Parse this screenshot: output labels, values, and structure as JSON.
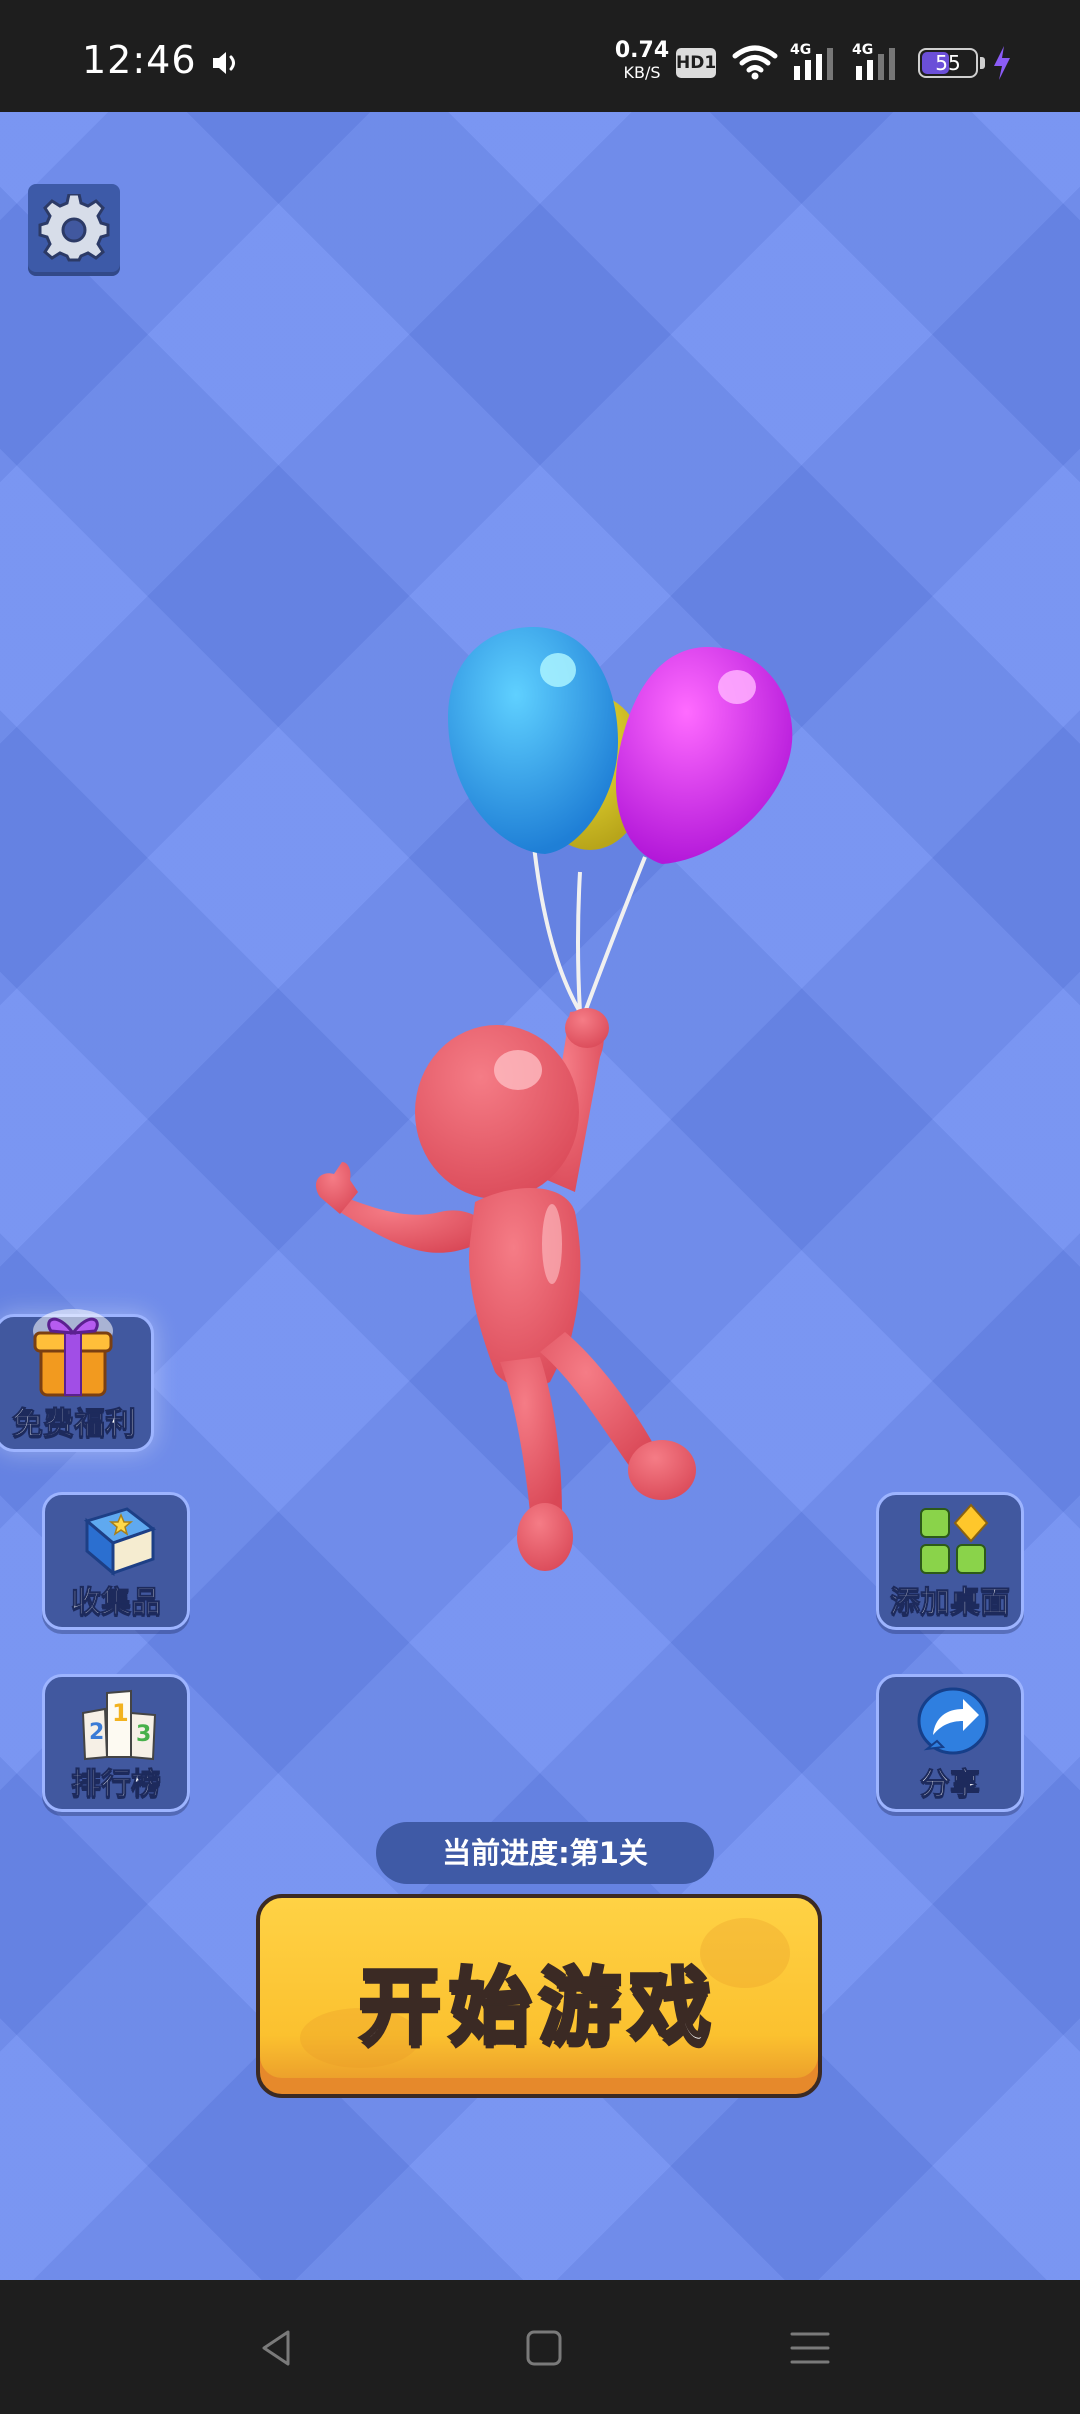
{
  "status_bar": {
    "time": "12:46",
    "net_speed_value": "0.74",
    "net_speed_unit": "KB/S",
    "hd_badge": "HD1",
    "signal_1_label": "4G",
    "signal_2_label": "4G",
    "battery_level": "55",
    "icons": [
      "speaker-icon",
      "wifi-icon",
      "signal-icon",
      "signal-icon",
      "battery-icon",
      "charging-bolt-icon"
    ]
  },
  "game": {
    "settings_icon": "gear-icon",
    "buttons": {
      "free_benefits": "免费福利",
      "collection": "收集品",
      "leaderboard": "排行榜",
      "add_to_desktop": "添加桌面",
      "share": "分享"
    },
    "button_icons": {
      "free_benefits": "gift-box-icon",
      "collection": "book-star-icon",
      "leaderboard": "podium-icon",
      "add_to_desktop": "app-grid-icon",
      "share": "share-arrow-icon"
    },
    "progress": "当前进度:第1关",
    "start_button": "开始游戏"
  },
  "colors": {
    "background": "#6b8af0",
    "button_blue": "#41589f",
    "start_yellow": "#fbc12f",
    "character": "#e95b68"
  },
  "nav_bar": {
    "icons": [
      "back-triangle-icon",
      "home-square-icon",
      "menu-lines-icon"
    ]
  }
}
